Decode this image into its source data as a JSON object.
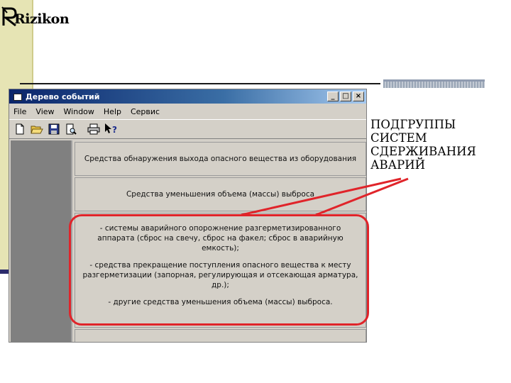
{
  "logo": {
    "text": "Rizikon"
  },
  "window": {
    "title": "Дерево событий",
    "controls": {
      "minimize": "_",
      "maximize": "□",
      "close": "×"
    }
  },
  "menu": [
    "File",
    "View",
    "Window",
    "Help",
    "Сервис"
  ],
  "toolbar": {
    "icons": [
      "new-file-icon",
      "open-folder-icon",
      "save-icon",
      "print-preview-icon",
      "print-icon",
      "help-pointer-icon"
    ]
  },
  "panels": {
    "detection": "Средства обнаружения выхода опасного вещества из оборудования",
    "reduction": "Средства уменьшения объема (массы) выброса",
    "details": [
      "- системы аварийного опорожнение разгерметизированного аппарата (сброс на свечу, сброс на факел; сброс в аварийную емкость);",
      "- средства прекращение поступления опасного вещества к месту разгерметизации (запорная, регулирующая и отсекающая арматура, др.);",
      "- другие средства уменьшения объема (массы) выброса."
    ]
  },
  "annotation": {
    "lines": [
      "ПОДГРУППЫ",
      "СИСТЕМ",
      "СДЕРЖИВАНИЯ",
      "АВАРИЙ"
    ],
    "color": "#e0242a"
  }
}
